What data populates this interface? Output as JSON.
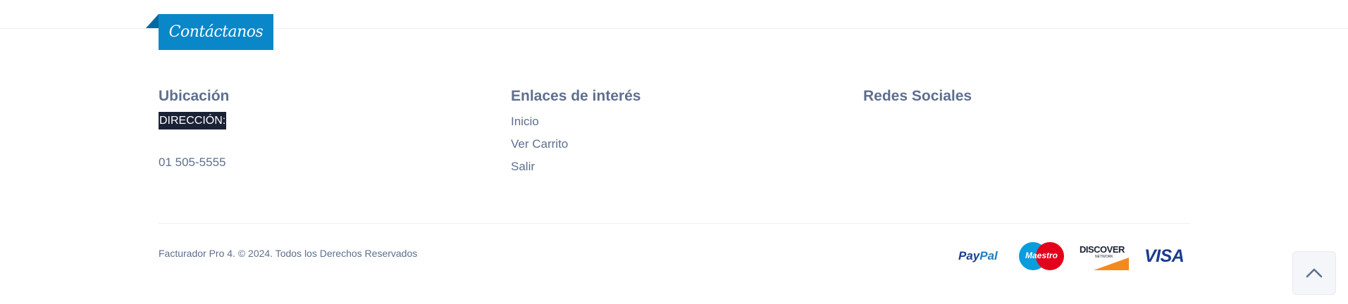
{
  "contact_tab": {
    "label": "Contáctanos"
  },
  "ubicacion": {
    "heading": "Ubicación",
    "direccion_label": "DIRECCIÓN:",
    "phone": "01 505-5555"
  },
  "enlaces": {
    "heading": "Enlaces de interés",
    "items": [
      {
        "label": "Inicio"
      },
      {
        "label": "Ver Carrito"
      },
      {
        "label": "Salir"
      }
    ]
  },
  "redes": {
    "heading": "Redes Sociales"
  },
  "footer": {
    "copyright": "Facturador Pro 4. © 2024. Todos los Derechos Reservados",
    "payments": {
      "paypal_main": "Pay",
      "paypal_accent": "Pal",
      "maestro": "Maestro",
      "discover": "DISCOVER",
      "discover_sub": "NETWORK",
      "visa": "VISA"
    }
  },
  "back_to_top": {
    "icon": "chevron-up-icon"
  },
  "colors": {
    "accent": "#0a87c9",
    "text": "#5f6f8e",
    "dark": "#1b2236"
  }
}
